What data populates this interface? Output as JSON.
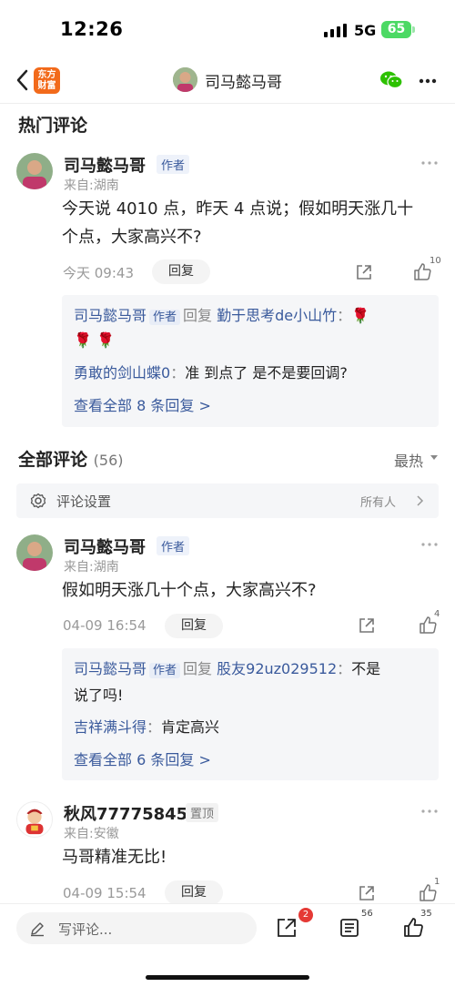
{
  "status_bar": {
    "time": "12:26",
    "network": "5G",
    "battery": "65"
  },
  "nav": {
    "brand_logo": "东方\n财富",
    "title": "司马懿马哥"
  },
  "hot_section": {
    "title": "热门评论"
  },
  "hot_comment": {
    "username": "司马懿马哥",
    "author_tag": "作者",
    "location": "来自:湖南",
    "text_line1": "今天说 4010 点，昨天 4 点说；假如明天涨几十",
    "text_line2": "个点，大家高兴不?",
    "timestamp": "今天 09:43",
    "reply_label": "回复",
    "like_count": "10",
    "replies": [
      {
        "name": "司马懿马哥",
        "author_tag": "作者",
        "reply_word": "回复",
        "target": "勤于思考de小山竹",
        "colon": "：",
        "text": "🌹",
        "text2": "🌹 🌹"
      },
      {
        "name": "勇敢的剑山蝶0",
        "colon": "：",
        "text": "准 到点了 是不是要回调?"
      }
    ],
    "view_all": "查看全部 8 条回复 >"
  },
  "all_section": {
    "title": "全部评论",
    "count": "(56)",
    "sort": "最热"
  },
  "settings": {
    "label": "评论设置",
    "value": "所有人"
  },
  "comment2": {
    "username": "司马懿马哥",
    "author_tag": "作者",
    "location": "来自:湖南",
    "text": "假如明天涨几十个点，大家高兴不?",
    "timestamp": "04-09 16:54",
    "reply_label": "回复",
    "like_count": "4",
    "replies": [
      {
        "name": "司马懿马哥",
        "author_tag": "作者",
        "reply_word": "回复",
        "target": "股友92uz029512",
        "colon": "：",
        "text": "不是",
        "text2": "说了吗!"
      },
      {
        "name": "吉祥满斗得",
        "colon": "：",
        "text": "肯定高兴"
      }
    ],
    "view_all": "查看全部 6 条回复 >"
  },
  "comment3": {
    "username": "秋风77775845",
    "pinned_tag": "置顶",
    "location": "来自:安徽",
    "text": "马哥精准无比!",
    "timestamp": "04-09 15:54",
    "reply_label": "回复",
    "like_count": "1"
  },
  "bottom_bar": {
    "write_placeholder": "写评论...",
    "share_badge": "2",
    "comment_count": "56",
    "like_count": "35"
  },
  "colors": {
    "accent_blue": "#3a5a9c",
    "brand_orange": "#f26a1b",
    "badge_red": "#e53935",
    "battery_green": "#4cd964"
  }
}
